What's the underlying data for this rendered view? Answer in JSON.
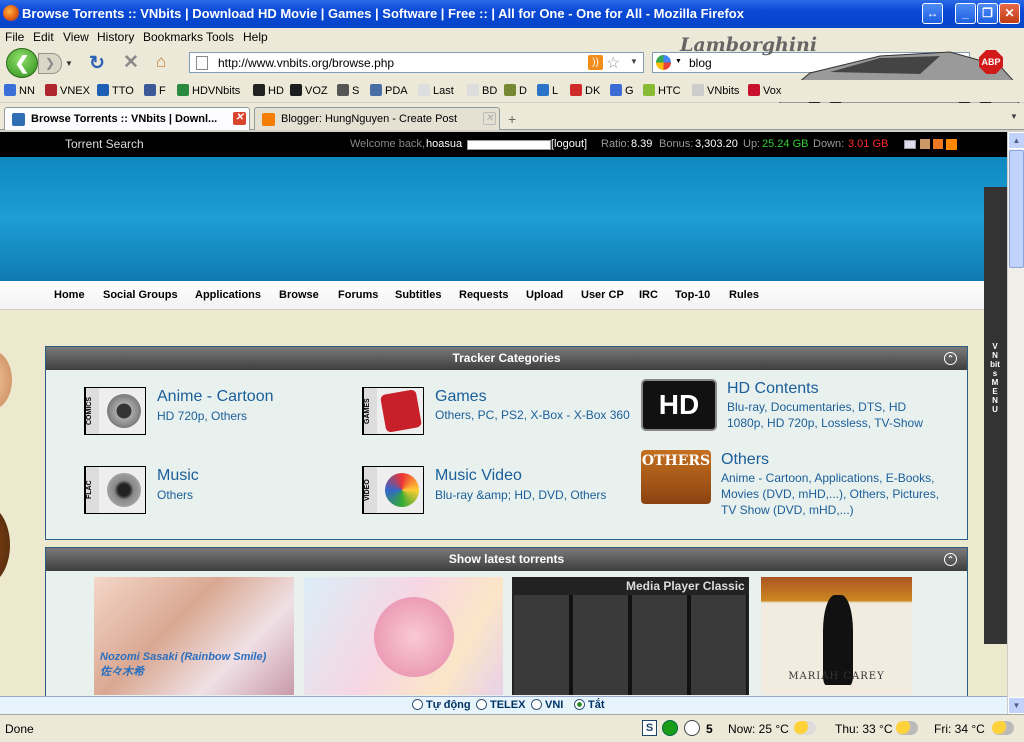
{
  "window": {
    "title": "Browse Torrents :: VNbits | Download HD Movie | Games | Software | Free :: | All for One - One for All - Mozilla Firefox"
  },
  "menu": [
    "File",
    "Edit",
    "View",
    "History",
    "Bookmarks",
    "Tools",
    "Help"
  ],
  "address": {
    "url": "http://www.vnbits.org/browse.php"
  },
  "search": {
    "value": "blog"
  },
  "brand": {
    "text": "Lamborghini"
  },
  "abp": "ABP",
  "bookmarks": [
    {
      "label": "NN",
      "color": "#3a6fd8"
    },
    {
      "label": "VNEX",
      "color": "#b0262f"
    },
    {
      "label": "TTO",
      "color": "#1c5fb5"
    },
    {
      "label": "F",
      "color": "#3b5998"
    },
    {
      "label": "HDVNbits",
      "color": "#2b8a3e"
    },
    {
      "label": "HD",
      "color": "#222222"
    },
    {
      "label": "VOZ",
      "color": "#1d1d1d"
    },
    {
      "label": "S",
      "color": "#555555"
    },
    {
      "label": "PDA",
      "color": "#4a6fa5"
    },
    {
      "label": "Last",
      "color": "#dddddd"
    },
    {
      "label": "BD",
      "color": "#dddddd"
    },
    {
      "label": "D",
      "color": "#778833"
    },
    {
      "label": "L",
      "color": "#2a73c9"
    },
    {
      "label": "DK",
      "color": "#d12a2a"
    },
    {
      "label": "G",
      "color": "#3d6bd4"
    },
    {
      "label": "HTC",
      "color": "#88bb33"
    },
    {
      "label": "VNbits",
      "color": "#cccccc"
    },
    {
      "label": "Vox",
      "color": "#c8102e"
    }
  ],
  "tabs": [
    {
      "label": "Browse Torrents :: VNbits | Downl...",
      "active": true
    },
    {
      "label": "Blogger: HungNguyen - Create Post",
      "active": false
    }
  ],
  "site": {
    "top_left": "Torrent Search",
    "welcome": "Welcome back,",
    "username": "hoasua",
    "logout": "[logout]",
    "ratio_label": "Ratio:",
    "ratio": "8.39",
    "bonus_label": "Bonus:",
    "bonus": "3,303.20",
    "up_label": "Up:",
    "up": "25.24 GB",
    "down_label": "Down:",
    "down": "3.01 GB",
    "colors": {
      "up": "#33cc33",
      "down": "#ff2a2a",
      "banner": "#1d9ed4"
    }
  },
  "nav": [
    "Home",
    "Social Groups",
    "Applications",
    "Browse",
    "Forums",
    "Subtitles",
    "Requests",
    "Upload",
    "User CP",
    "IRC",
    "Top-10",
    "Rules"
  ],
  "side_menu": "VNbits MENU",
  "categories_title": "Tracker Categories",
  "categories": [
    {
      "name": "Anime - Cartoon",
      "sub": "HD 720p, Others",
      "icon": "COMICS"
    },
    {
      "name": "Games",
      "sub": "Others, PC, PS2, X-Box - X-Box 360",
      "icon": "GAMES"
    },
    {
      "name": "HD Contents",
      "sub": "Blu-ray, Documentaries, DTS, HD 1080p, HD 720p, Lossless, TV-Show",
      "icon": "HD"
    },
    {
      "name": "Music",
      "sub": "Others",
      "icon": "FLAC"
    },
    {
      "name": "Music Video",
      "sub": "Blu-ray &amp; HD, DVD, Others",
      "icon": "VIDEO"
    },
    {
      "name": "Others",
      "sub": "Anime - Cartoon, Applications, E-Books, Movies (DVD, mHD,...), Others, Pictures, TV Show (DVD, mHD,...)",
      "icon": "OTHERS"
    }
  ],
  "latest_title": "Show latest torrents",
  "thumbs": [
    {
      "caption": "Nozomi Sasaki (Rainbow Smile)  佐々木希"
    },
    {
      "caption": ""
    },
    {
      "caption": "Media Player Classic"
    },
    {
      "caption": "MARIAH CAREY"
    }
  ],
  "ime": [
    "Tự động",
    "TELEX",
    "VNI",
    "Tắt"
  ],
  "status": {
    "left": "Done",
    "now": "Now: 25 °C",
    "thu": "Thu: 33 °C",
    "fri": "Fri: 34 °C",
    "five": "5"
  }
}
